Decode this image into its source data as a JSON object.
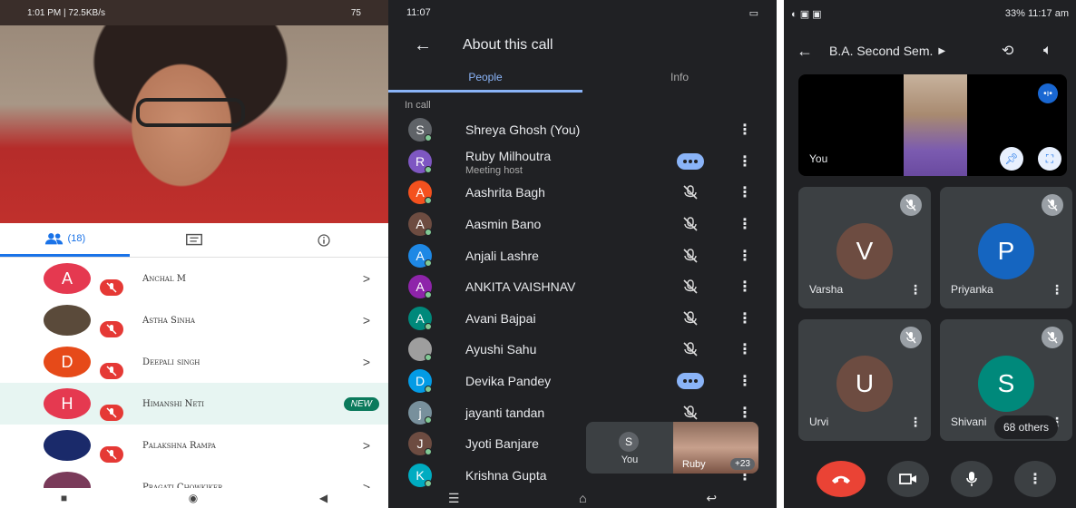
{
  "panel1": {
    "status_left": "1:01 PM | 72.5KB/s",
    "status_right": "75",
    "people_count": "(18)",
    "participants": [
      {
        "name": "Anchal M",
        "initial": "A",
        "color": "#e53950"
      },
      {
        "name": "Astha Sinha",
        "initial": "",
        "color": "#5a4a3a"
      },
      {
        "name": "Deepali singh",
        "initial": "D",
        "color": "#e64a19"
      },
      {
        "name": "Himanshi Neti",
        "initial": "H",
        "color": "#e53950",
        "badge": "NEW"
      },
      {
        "name": "Palakshna Rampa",
        "initial": "",
        "color": "#1a2a6a"
      },
      {
        "name": "Pragati Chowkiker",
        "initial": "",
        "color": "#7a3b5a"
      }
    ],
    "chevron": ">"
  },
  "panel2": {
    "status_time": "11:07",
    "title": "About this call",
    "tabs": [
      "People",
      "Info"
    ],
    "section": "In call",
    "participants": [
      {
        "name": "Shreya Ghosh (You)",
        "initial": "S",
        "color": "#5f6368",
        "status": "none"
      },
      {
        "name": "Ruby Milhoutra",
        "sub": "Meeting host",
        "initial": "R",
        "color": "#7e57c2",
        "status": "talk"
      },
      {
        "name": "Aashrita Bagh",
        "initial": "A",
        "color": "#f4511e",
        "status": "muted"
      },
      {
        "name": "Aasmin Bano",
        "initial": "A",
        "color": "#6d4c41",
        "status": "muted"
      },
      {
        "name": "Anjali Lashre",
        "initial": "A",
        "color": "#1e88e5",
        "status": "muted"
      },
      {
        "name": "ANKITA VAISHNAV",
        "initial": "A",
        "color": "#8e24aa",
        "status": "muted"
      },
      {
        "name": "Avani Bajpai",
        "initial": "A",
        "color": "#00897b",
        "status": "muted"
      },
      {
        "name": "Ayushi Sahu",
        "initial": "",
        "color": "#9e9e9e",
        "status": "muted"
      },
      {
        "name": "Devika Pandey",
        "initial": "D",
        "color": "#039be5",
        "status": "talk"
      },
      {
        "name": "jayanti tandan",
        "initial": "j",
        "color": "#78909c",
        "status": "muted"
      },
      {
        "name": "Jyoti Banjare",
        "initial": "J",
        "color": "#6d4c41",
        "status": "none"
      },
      {
        "name": "Krishna Gupta",
        "initial": "K",
        "color": "#00acc1",
        "status": "none"
      }
    ],
    "pip": {
      "self_initial": "S",
      "self_label": "You",
      "other_label": "Ruby",
      "more": "+23"
    }
  },
  "panel3": {
    "status_right": "33%  11:17 am",
    "title": "B.A. Second Sem.",
    "self_label": "You",
    "tiles": [
      {
        "name": "Varsha",
        "initial": "V",
        "color": "#6d4c41"
      },
      {
        "name": "Priyanka",
        "initial": "P",
        "color": "#1565c0"
      },
      {
        "name": "Urvi",
        "initial": "U",
        "color": "#6d4c41"
      },
      {
        "name": "Shivani",
        "initial": "S",
        "color": "#00897b"
      }
    ],
    "others": "68 others"
  }
}
